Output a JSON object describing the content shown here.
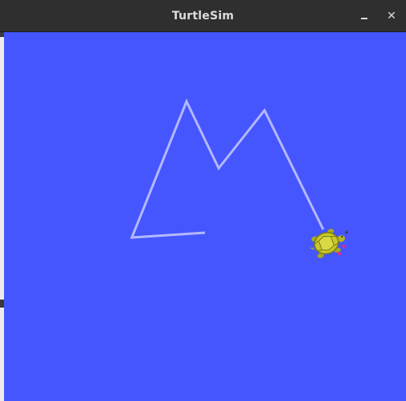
{
  "window": {
    "title": "TurtleSim",
    "minimize_symbol": "–",
    "close_symbol": "✕"
  },
  "canvas": {
    "background_color": "#4556ff",
    "pen_color": "#b3b8ff"
  },
  "turtle": {
    "icon": "turtle-icon",
    "shell_color": "#c8c82e",
    "accent_color": "#e02a8c"
  }
}
